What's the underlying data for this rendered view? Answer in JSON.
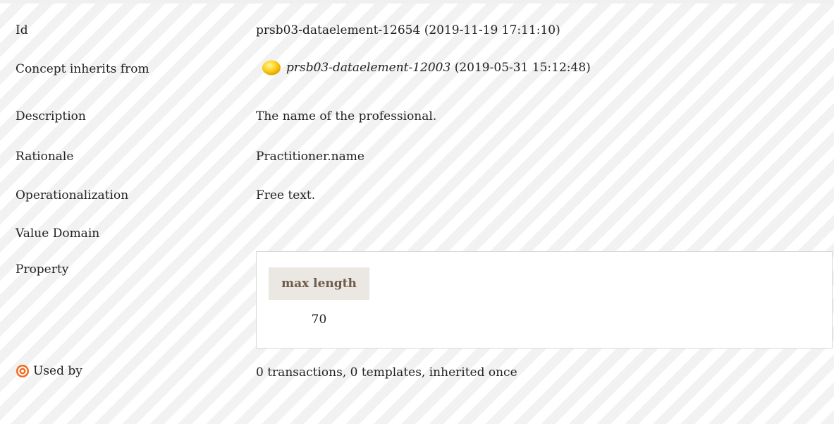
{
  "rows": {
    "id": {
      "label": "Id",
      "value": "prsb03-dataelement-12654 (2019-11-19 17:11:10)"
    },
    "inherits": {
      "label": "Concept inherits from",
      "icon": "concept-status-icon",
      "link": "prsb03-dataelement-12003",
      "suffix": " (2019-05-31 15:12:48)"
    },
    "description": {
      "label": "Description",
      "value": "The name of the professional."
    },
    "rationale": {
      "label": "Rationale",
      "value": "Practitioner.name"
    },
    "operationalization": {
      "label": "Operationalization",
      "value": "Free text."
    },
    "value_domain": {
      "label": "Value Domain"
    },
    "property": {
      "label": "Property",
      "header": "max length",
      "value": "70"
    },
    "used_by": {
      "label": "Used by",
      "icon": "target-icon",
      "value": "0 transactions, 0 templates, inherited once"
    }
  },
  "colors": {
    "status_sun": "#f5b800",
    "target_orange": "#f26a21",
    "header_bg": "#ebe7e2",
    "header_text": "#6f5c4a"
  }
}
